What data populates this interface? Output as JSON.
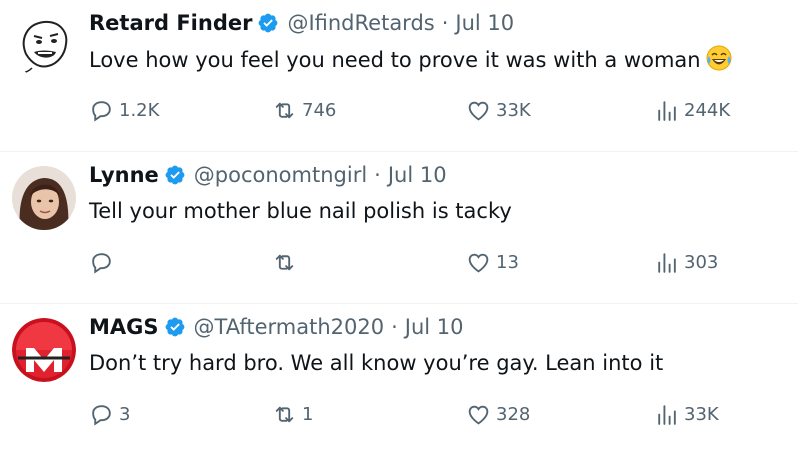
{
  "tweets": [
    {
      "name": "Retard Finder",
      "handle": "@IfindRetards",
      "separator": "·",
      "date": "Jul 10",
      "text": "Love how you feel you need to prove it was with a woman",
      "emoji": "face-with-tears-of-joy",
      "replies": "1.2K",
      "retweets": "746",
      "likes": "33K",
      "views": "244K"
    },
    {
      "name": "Lynne",
      "handle": "@poconomtngirl",
      "separator": "·",
      "date": "Jul 10",
      "text": "Tell your mother blue nail polish is tacky",
      "replies": "",
      "retweets": "",
      "likes": "13",
      "views": "303"
    },
    {
      "name": "MAGS",
      "handle": "@TAftermath2020",
      "separator": "·",
      "date": "Jul 10",
      "text": "Don’t try hard bro. We all know you’re gay. Lean into it",
      "replies": "3",
      "retweets": "1",
      "likes": "328",
      "views": "33K"
    }
  ],
  "colors": {
    "verified": "#1d9bf0",
    "secondary_text": "#536471",
    "primary_text": "#0f1419",
    "divider": "#eff3f4"
  }
}
